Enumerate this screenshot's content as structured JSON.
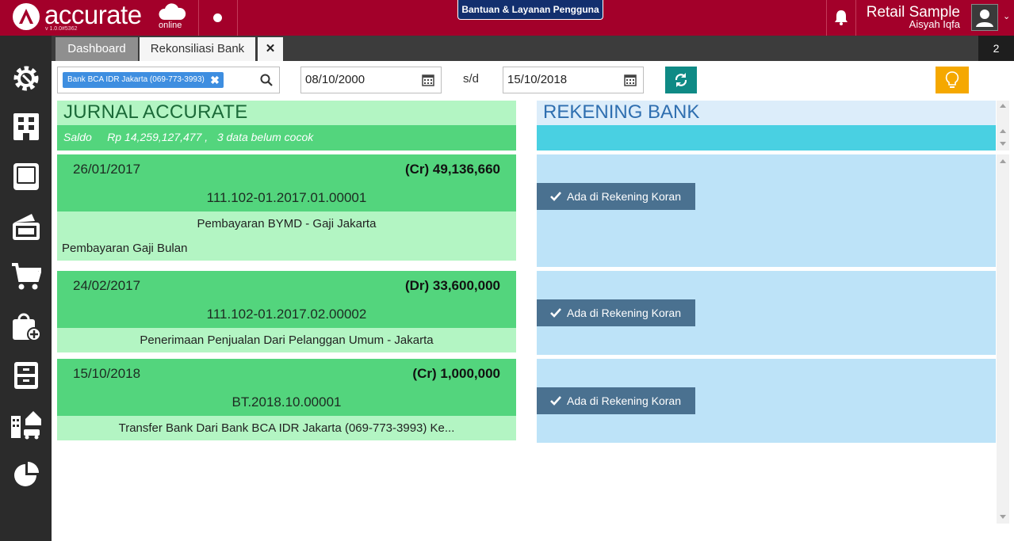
{
  "header": {
    "logo_text": "accurate",
    "logo_sub": "online",
    "version": "v 1.0.0#5362",
    "help_label": "Bantuan & Layanan Pengguna",
    "company": "Retail Sample",
    "user": "Aisyah Iqfa"
  },
  "tabs": {
    "dashboard": "Dashboard",
    "rekonsiliasi": "Rekonsiliasi Bank",
    "close": "✕",
    "count": "2"
  },
  "filter": {
    "bank": "Bank BCA IDR Jakarta (069-773-3993)",
    "chip_close": "✖",
    "date_from": "08/10/2000",
    "separator": "s/d",
    "date_to": "15/10/2018"
  },
  "jurnal": {
    "title": "JURNAL ACCURATE",
    "saldo_label": "Saldo",
    "saldo_value": "Rp 14,259,127,477 ,",
    "unmatched": "3 data belum cocok",
    "entries": [
      {
        "date": "26/01/2017",
        "amount": "(Cr) 49,136,660",
        "ref": "111.102-01.2017.01.00001",
        "description": "Pembayaran BYMD - Gaji Jakarta",
        "note": "Pembayaran Gaji Bulan"
      },
      {
        "date": "24/02/2017",
        "amount": "(Dr) 33,600,000",
        "ref": "111.102-01.2017.02.00002",
        "description": "Penerimaan Penjualan Dari Pelanggan Umum - Jakarta"
      },
      {
        "date": "15/10/2018",
        "amount": "(Cr) 1,000,000",
        "ref": "BT.2018.10.00001",
        "description": "Transfer Bank Dari Bank BCA IDR Jakarta (069-773-3993) Ke..."
      }
    ]
  },
  "rekening": {
    "title": "REKENING BANK",
    "ada_label": "Ada di Rekening Koran"
  },
  "colors": {
    "brand": "#a3002a",
    "sidebar": "#2b2b2b",
    "jurnal_green": "#53d57d",
    "jurnal_light": "#b3f5c3",
    "rekening_blue": "#bde3f8",
    "ada_button": "#4a7190"
  },
  "icons": {
    "sidebar": [
      "gear-icon",
      "building-icon",
      "book-icon",
      "wallet-icon",
      "cart-icon",
      "bag-add-icon",
      "cabinet-icon",
      "assets-icon",
      "pie-chart-icon"
    ]
  }
}
